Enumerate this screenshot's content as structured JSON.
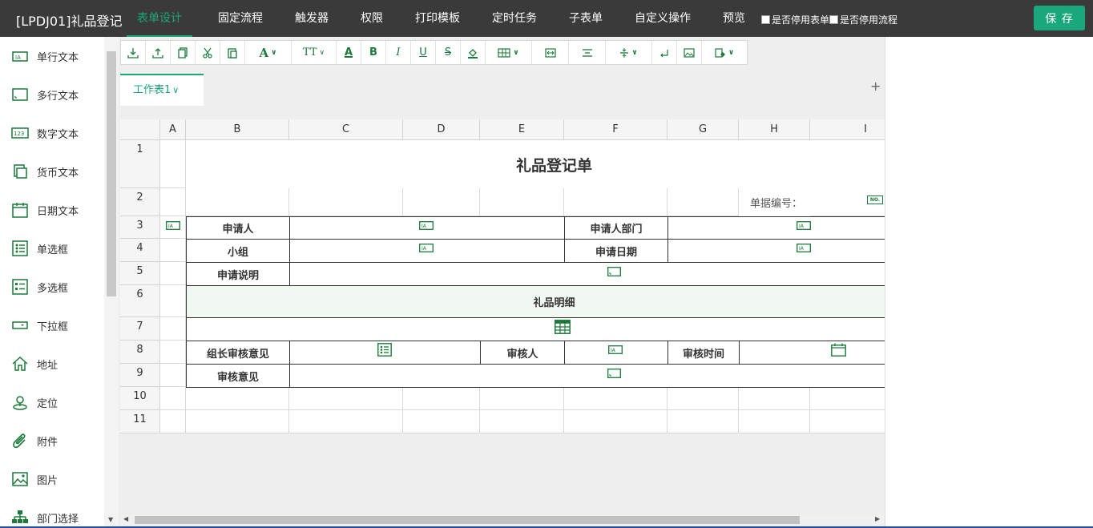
{
  "app": {
    "title": "[LPDJ01]礼品登记",
    "save_label": "保 存"
  },
  "nav": {
    "tabs": [
      "表单设计",
      "固定流程",
      "触发器",
      "权限",
      "打印模板",
      "定时任务",
      "子表单",
      "自定义操作",
      "预览"
    ],
    "active": 0,
    "checkbox_form": "是否停用表单",
    "checkbox_flow": "是否停用流程"
  },
  "sidebar": {
    "items": [
      {
        "label": "单行文本",
        "icon": "single-line-text-icon"
      },
      {
        "label": "多行文本",
        "icon": "multi-line-text-icon"
      },
      {
        "label": "数字文本",
        "icon": "number-text-icon"
      },
      {
        "label": "货币文本",
        "icon": "currency-text-icon"
      },
      {
        "label": "日期文本",
        "icon": "date-text-icon"
      },
      {
        "label": "单选框",
        "icon": "radio-list-icon"
      },
      {
        "label": "多选框",
        "icon": "checkbox-list-icon"
      },
      {
        "label": "下拉框",
        "icon": "dropdown-icon"
      },
      {
        "label": "地址",
        "icon": "home-icon"
      },
      {
        "label": "定位",
        "icon": "location-pin-icon"
      },
      {
        "label": "附件",
        "icon": "paperclip-icon"
      },
      {
        "label": "图片",
        "icon": "image-icon"
      },
      {
        "label": "部门选择",
        "icon": "org-chart-icon"
      }
    ]
  },
  "toolbar": {
    "text_glyphs": {
      "font": "A",
      "size": "TT",
      "color": "A",
      "bold": "B",
      "italic": "I",
      "underline": "U",
      "strike": "S"
    }
  },
  "sheet": {
    "tab_label": "工作表1",
    "add_label": "+",
    "columns": [
      "A",
      "B",
      "C",
      "D",
      "E",
      "F",
      "G",
      "H",
      "I"
    ],
    "rows": [
      "1",
      "2",
      "3",
      "4",
      "5",
      "6",
      "7",
      "8",
      "9",
      "10",
      "11"
    ],
    "title": "礼品登记单",
    "doc_no_label": "单据编号：",
    "doc_no_badge": "NO.",
    "applicant": "申请人",
    "applicant_dept": "申请人部门",
    "group": "小组",
    "apply_date": "申请日期",
    "apply_desc": "申请说明",
    "gift_detail": "礼品明细",
    "leader_opinion": "组长审核意见",
    "reviewer": "审核人",
    "review_time": "审核时间",
    "review_opinion": "审核意见"
  },
  "colors": {
    "accent": "#1aa77a",
    "topbar": "#3a3a3a",
    "icon_green": "#1b7a3a"
  }
}
